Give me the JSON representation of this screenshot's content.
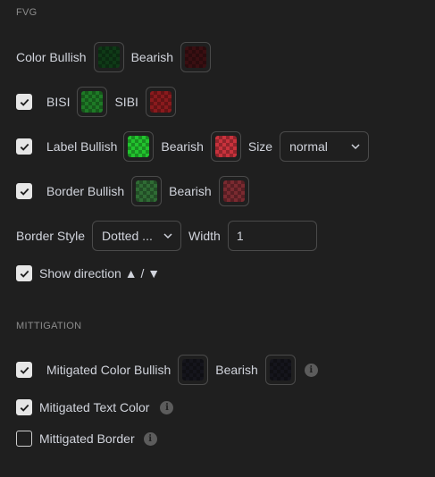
{
  "fvg": {
    "section_title": "FVG",
    "color_row": {
      "label": "Color Bullish",
      "bearish_label": "Bearish"
    },
    "bisi_row": {
      "checked": true,
      "label": "BISI",
      "sibi_label": "SIBI"
    },
    "label_row": {
      "checked": true,
      "label": "Label Bullish",
      "bearish_label": "Bearish",
      "size_label": "Size",
      "size_value": "normal"
    },
    "border_row": {
      "checked": true,
      "label": "Border Bullish",
      "bearish_label": "Bearish"
    },
    "border_style_row": {
      "label": "Border Style",
      "style_value": "Dotted ...",
      "width_label": "Width",
      "width_value": "1"
    },
    "direction_row": {
      "checked": true,
      "label": "Show direction ▲ / ▼"
    }
  },
  "mitigation": {
    "section_title": "MITTIGATION",
    "color_row": {
      "checked": true,
      "label": "Mitigated Color Bullish",
      "bearish_label": "Bearish"
    },
    "text_color_row": {
      "checked": true,
      "label": "Mitigated Text Color"
    },
    "border_row": {
      "checked": false,
      "label": "Mittigated Border"
    }
  },
  "colors": {
    "color_bullish": "#0f3a17",
    "color_bearish": "#3a0f12",
    "bisi": "#1e7a26",
    "sibi": "#8a1a1d",
    "label_bullish": "#22c32e",
    "label_bearish": "#c8323c",
    "border_bullish": "#2f6b34",
    "border_bearish": "#7a2a30",
    "mitigated_bullish": "#15151c",
    "mitigated_bearish": "#15151c"
  },
  "icons": {
    "checkbox": "check-icon",
    "dropdown": "chevron-down-icon",
    "info": "info-icon"
  }
}
